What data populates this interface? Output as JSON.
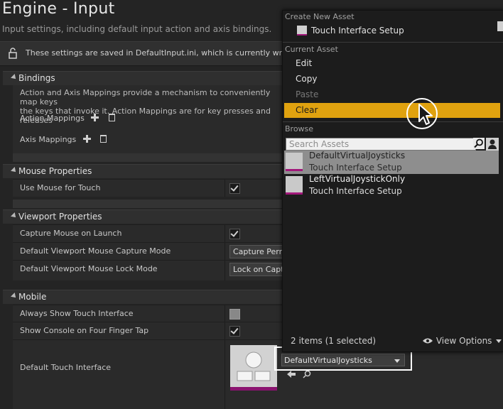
{
  "page": {
    "title": "Engine - Input",
    "subtitle": "Input settings, including default input action and axis bindings."
  },
  "notice": {
    "text": "These settings are saved in DefaultInput.ini, which is currently writable."
  },
  "bindings": {
    "header": "Bindings",
    "desc_line1": "Action and Axis Mappings provide a mechanism to conveniently map keys",
    "desc_line2": "the keys that invoke it. Action Mappings are for key presses and releases",
    "action_label": "Action Mappings",
    "axis_label": "Axis Mappings"
  },
  "mouse": {
    "header": "Mouse Properties",
    "use_mouse_for_touch": "Use Mouse for Touch"
  },
  "viewport": {
    "header": "Viewport Properties",
    "capture_on_launch": "Capture Mouse on Launch",
    "capture_mode_label": "Default Viewport Mouse Capture Mode",
    "capture_mode_value": "Capture Perma",
    "lock_mode_label": "Default Viewport Mouse Lock Mode",
    "lock_mode_value": "Lock on Captu"
  },
  "mobile": {
    "header": "Mobile",
    "always_show_touch": "Always Show Touch Interface",
    "console_four_finger": "Show Console on Four Finger Tap",
    "default_touch_label": "Default Touch Interface",
    "default_touch_value": "DefaultVirtualJoysticks"
  },
  "menu": {
    "create_header": "Create New Asset",
    "create_item": "Touch Interface Setup",
    "current_header": "Current Asset",
    "edit": "Edit",
    "copy": "Copy",
    "paste": "Paste",
    "clear": "Clear",
    "browse_header": "Browse",
    "search_placeholder": "Search Assets",
    "assets": [
      {
        "name": "DefaultVirtualJoysticks",
        "type": "Touch Interface Setup"
      },
      {
        "name": "LeftVirtualJoystickOnly",
        "type": "Touch Interface Setup"
      }
    ],
    "footer_count": "2 items (1 selected)",
    "view_options": "View Options"
  },
  "colors": {
    "highlight": "#e0a20f",
    "asset_accent": "#a3187b",
    "background": "#242424"
  }
}
